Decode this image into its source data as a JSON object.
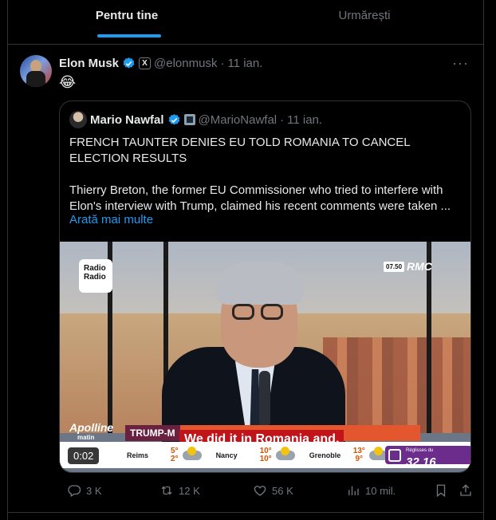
{
  "tabs": [
    {
      "label": "Pentru tine",
      "active": true
    },
    {
      "label": "Urmărești",
      "active": false
    }
  ],
  "post": {
    "author_name": "Elon Musk",
    "author_handle": "@elonmusk",
    "date_sep": "·",
    "date": "11 ian.",
    "text": "😂",
    "more_icon": "more-horizontal-icon",
    "quote": {
      "author_name": "Mario Nawfal",
      "author_handle": "@MarioNawfal",
      "date_sep": "·",
      "date": "11 ian.",
      "paragraph1": "FRENCH TAUNTER DENIES EU TOLD ROMANIA TO CANCEL ELECTION RESULTS",
      "paragraph2": "Thierry Breton, the former EU Commissioner who tried to interfere with Elon's interview with Trump, claimed his recent comments were taken ...",
      "show_more": "Arată mai multe",
      "video": {
        "time": "0:02",
        "subtitle": "We did it in Romania and,",
        "channel_logo": "Radio\nRadio",
        "rmc_time": "07.50",
        "rmc_logo": "RMC",
        "strip_label": "TRUMP-M",
        "show_name": "Apolline",
        "show_sub": "matin",
        "weather": [
          {
            "city": "Reims",
            "high": "5°",
            "low": "2°"
          },
          {
            "city": "Nancy",
            "high": "10°",
            "low": "10°"
          },
          {
            "city": "Grenoble",
            "high": "13°",
            "low": "9°"
          }
        ],
        "promo_text": "Réglisses du",
        "promo_hours": "32 16"
      }
    },
    "actions": {
      "replies": "3 K",
      "reposts": "12 K",
      "likes": "56 K",
      "views": "10 mil."
    }
  },
  "colors": {
    "accent": "#1d9bf0",
    "muted": "#71767b",
    "border": "#2f3336",
    "background": "#000000"
  }
}
